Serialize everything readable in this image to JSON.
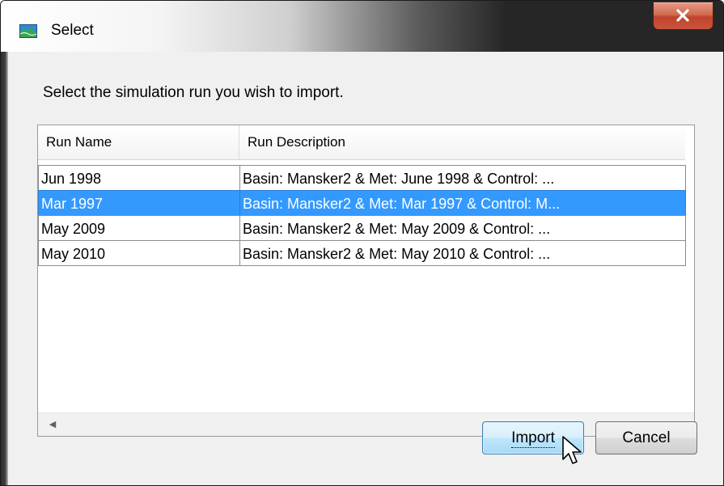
{
  "window": {
    "title": "Select",
    "app_icon": "landscape-icon"
  },
  "prompt": "Select the simulation run you wish to import.",
  "table": {
    "columns": [
      "Run Name",
      "Run Description"
    ],
    "rows": [
      {
        "name": "Jun 1998",
        "description": "Basin: Mansker2  &  Met: June 1998  &  Control: ...",
        "selected": false
      },
      {
        "name": "Mar 1997",
        "description": "Basin: Mansker2  &  Met: Mar 1997  &  Control: M...",
        "selected": true
      },
      {
        "name": "May 2009",
        "description": "Basin: Mansker2  &  Met: May 2009  &  Control: ...",
        "selected": false
      },
      {
        "name": "May 2010",
        "description": "Basin: Mansker2  &  Met: May 2010  &  Control: ...",
        "selected": false
      }
    ]
  },
  "buttons": {
    "import_label": "Import",
    "cancel_label": "Cancel"
  },
  "colors": {
    "selection": "#3399ff",
    "close_button": "#c9553c",
    "titlebar_dark": "#262626"
  }
}
